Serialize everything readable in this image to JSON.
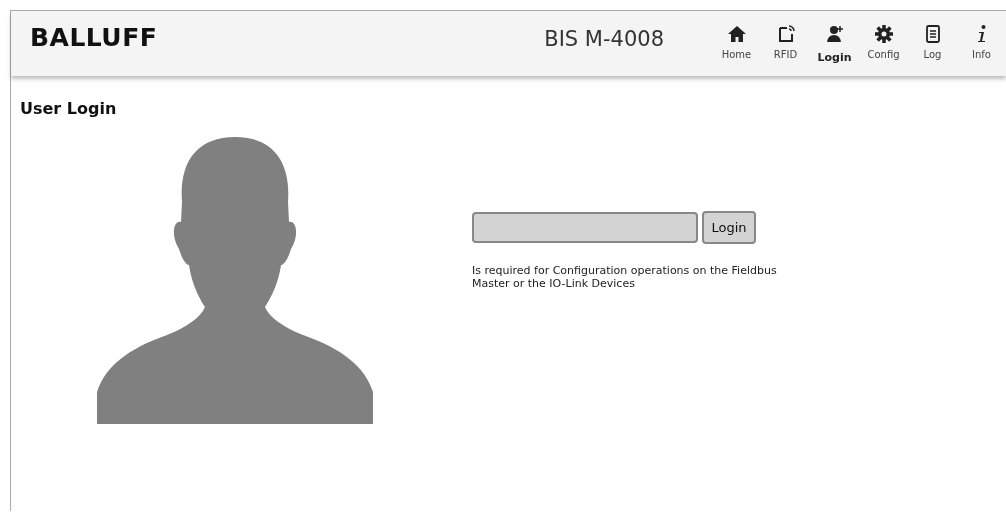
{
  "header": {
    "logo": "BALLUFF",
    "device": "BIS M-4008"
  },
  "nav": [
    {
      "kind": "home",
      "label": "Home",
      "selected": false
    },
    {
      "kind": "rfid",
      "label": "RFID",
      "selected": false
    },
    {
      "kind": "login",
      "label": "Login",
      "selected": true
    },
    {
      "kind": "config",
      "label": "Config",
      "selected": false
    },
    {
      "kind": "log",
      "label": "Log",
      "selected": false
    },
    {
      "kind": "info",
      "label": "Info",
      "selected": false
    }
  ],
  "page_title": "User Login",
  "login": {
    "button": "Login",
    "note": "Is required for Configuration operations on the Fieldbus Master or the IO-Link Devices"
  }
}
